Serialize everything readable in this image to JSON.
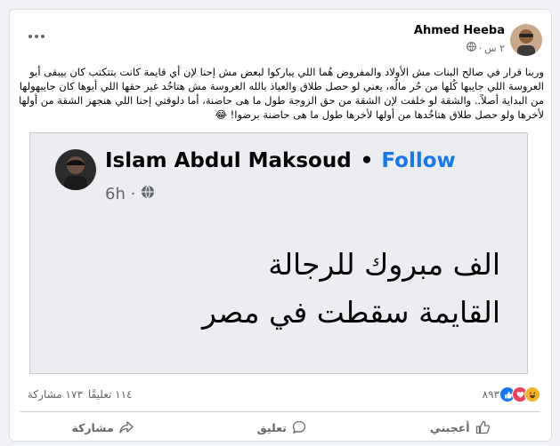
{
  "post": {
    "author": "Ahmed Heeba",
    "time": "٢ س",
    "separator": "·",
    "audience_icon": "globe-icon",
    "more_icon": "more-icon",
    "text": "وربنا قرار في صالح البنات مش الأولاد والمفروض هُما اللي يباركوا لبعض مش إحنا لإن أي قايمة كانت بتتكتب كان بيبقى أبو العروسة اللي جايبها كُلها من حُر مالُه، يعني لو حصل طلاق والعياذ بالله العروسة مش هتاخُد غير حقها اللي أبوها كان جايبهولها من البداية أصلاً.. والشقة لو خلفت لإن الشقة من حق الزوجة طول ما هى حاضنة، أما دلوقتي إحنا اللي هنجهز الشقة من أولها لأخرها ولو حصل طلاق هتاخُدها من أولها لأخرها طول ما هى حاضنة برضوا! 😂"
  },
  "shared": {
    "name": "Islam Abdul Maksoud",
    "dot": "•",
    "follow": "Follow",
    "time": "6h ·",
    "line1": "الف مبروك للرجالة",
    "line2": "القايمة سقطت في مصر"
  },
  "stats": {
    "reaction_count": "٨٩٣",
    "reaction_types": [
      "haha",
      "love",
      "like"
    ],
    "comments": "١١٤ تعليقًا",
    "shares": "١٧٣ مشاركة"
  },
  "actions": {
    "like": "أعجبني",
    "comment": "تعليق",
    "share": "مشاركة"
  },
  "colors": {
    "like_blue": "#1877f2",
    "love_red": "#f33e58",
    "haha_yellow": "#f7b125",
    "secondary_text": "#65676b"
  }
}
